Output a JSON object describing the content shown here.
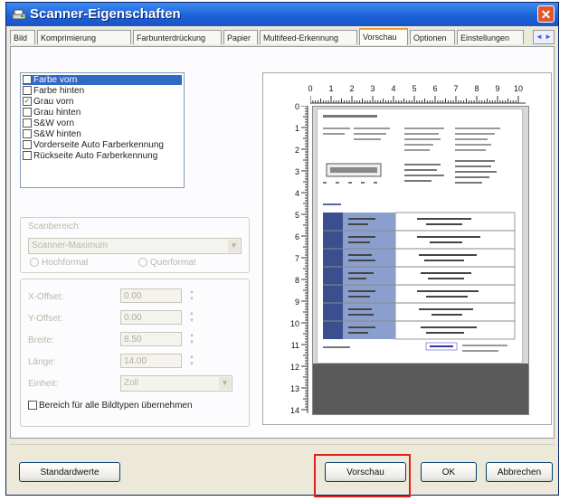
{
  "window": {
    "title": "Scanner-Eigenschaften",
    "close_label": "✕"
  },
  "tabs": [
    {
      "label": "Bild"
    },
    {
      "label": "Komprimierung"
    },
    {
      "label": "Farbunterdrückung"
    },
    {
      "label": "Papier"
    },
    {
      "label": "Multifeed-Erkennung"
    },
    {
      "label": "Vorschau"
    },
    {
      "label": "Optionen"
    },
    {
      "label": "Einstellungen"
    }
  ],
  "tab_scroll_label": "◄ ►",
  "active_tab": "Vorschau",
  "image_list": [
    {
      "label": "Farbe vorn",
      "checked": false,
      "selected": true
    },
    {
      "label": "Farbe hinten",
      "checked": false,
      "selected": false
    },
    {
      "label": "Grau vorn",
      "checked": true,
      "selected": false
    },
    {
      "label": "Grau hinten",
      "checked": false,
      "selected": false
    },
    {
      "label": "S&W vorn",
      "checked": false,
      "selected": false
    },
    {
      "label": "S&W hinten",
      "checked": false,
      "selected": false
    },
    {
      "label": "Vorderseite Auto Farberkennung",
      "checked": false,
      "selected": false
    },
    {
      "label": "Rückseite Auto Farberkennung",
      "checked": false,
      "selected": false
    }
  ],
  "scan_area": {
    "label": "Scanbereich:",
    "value": "Scanner-Maximum",
    "orientation_portrait": "Hochformat",
    "orientation_landscape": "Querformat"
  },
  "offsets": {
    "x_label": "X-Offset:",
    "x_value": "0.00",
    "y_label": "Y-Offset:",
    "y_value": "0.00",
    "width_label": "Breite:",
    "width_value": "8.50",
    "length_label": "Länge:",
    "length_value": "14.00",
    "unit_label": "Einheit:",
    "unit_value": "Zoll"
  },
  "apply_all_label": "Bereich für alle Bildtypen übernehmen",
  "ruler": {
    "top": [
      "0",
      "1",
      "2",
      "3",
      "4",
      "5",
      "6",
      "7",
      "8",
      "9",
      "10"
    ],
    "left": [
      "0",
      "1",
      "2",
      "3",
      "4",
      "5",
      "6",
      "7",
      "8",
      "9",
      "10",
      "11",
      "12",
      "13",
      "14"
    ]
  },
  "buttons": {
    "defaults": "Standardwerte",
    "preview": "Vorschau",
    "ok": "OK",
    "cancel": "Abbrechen"
  },
  "colors": {
    "highlight": "#e02020",
    "selection": "#316ac5",
    "titlebar": "#1c5fd6"
  }
}
